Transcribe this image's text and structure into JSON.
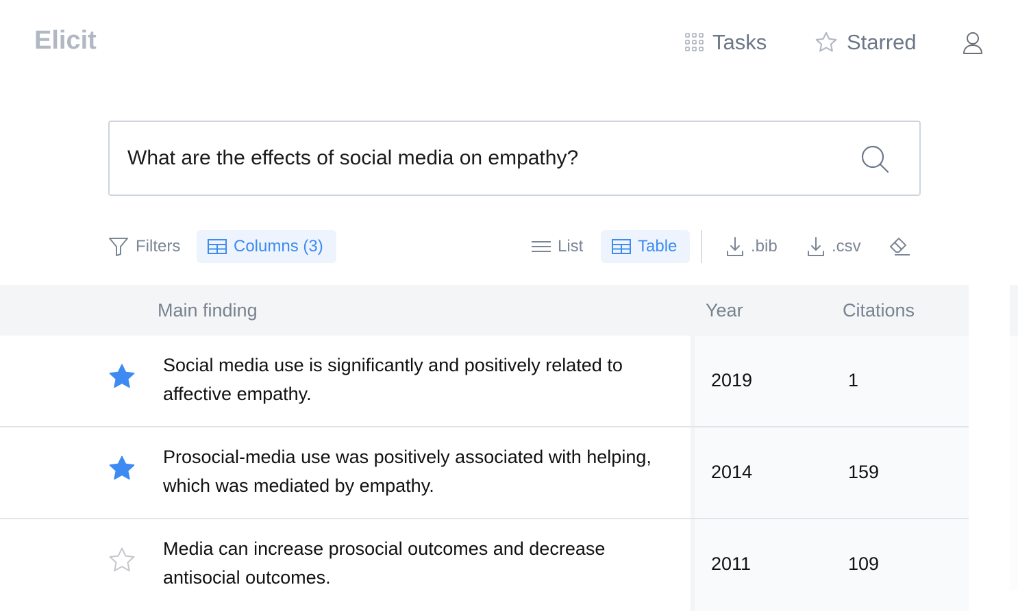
{
  "app": {
    "logo": "Elicit"
  },
  "nav": {
    "tasks_label": "Tasks",
    "starred_label": "Starred",
    "user_icon": "user-icon"
  },
  "search": {
    "value": "What are the effects of social media on empathy?",
    "icon": "search-icon"
  },
  "toolbar": {
    "filters_label": "Filters",
    "columns_label": "Columns (3)",
    "list_label": "List",
    "table_label": "Table",
    "bib_label": ".bib",
    "csv_label": ".csv",
    "active_view": "Table"
  },
  "table": {
    "headers": [
      "Main finding",
      "Year",
      "Citations"
    ],
    "rows": [
      {
        "starred": true,
        "finding": "Social media use is significantly and positively related to affective empathy.",
        "year": "2019",
        "citations": "1"
      },
      {
        "starred": true,
        "finding": "Prosocial-media use was positively associated with helping, which was mediated by empathy.",
        "year": "2014",
        "citations": "159"
      },
      {
        "starred": false,
        "finding": "Media can increase prosocial outcomes and decrease antisocial outcomes.",
        "year": "2011",
        "citations": "109"
      }
    ]
  },
  "colors": {
    "accent": "#3d8bf2",
    "accent_bg": "#eef4fd",
    "muted_text": "#7a8596",
    "logo": "#b1b8c3",
    "header_bg": "#f4f5f7"
  }
}
